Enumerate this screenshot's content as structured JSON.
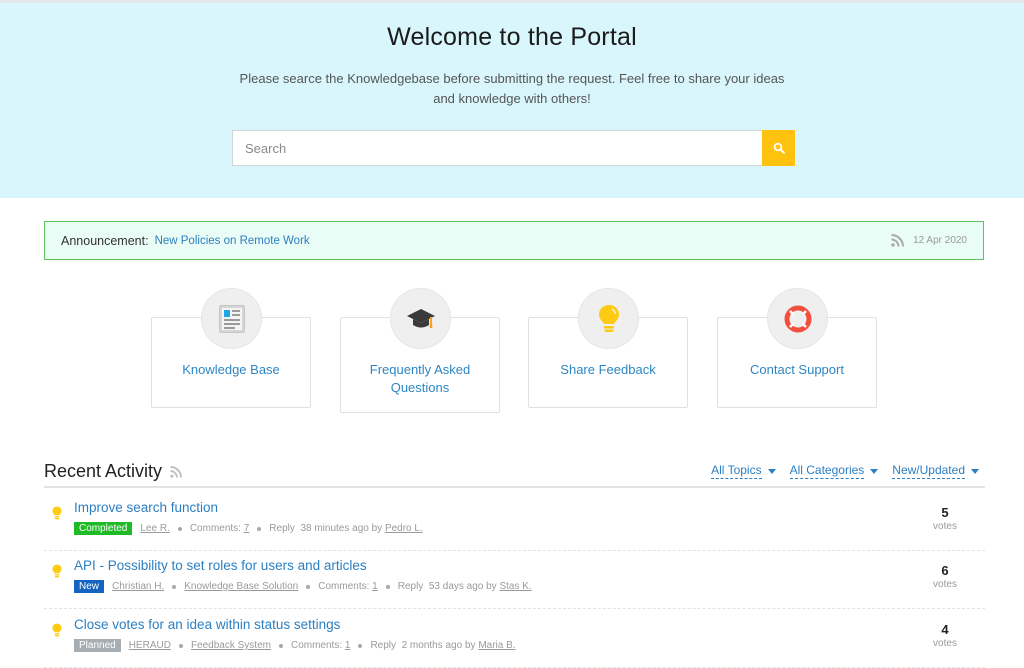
{
  "hero": {
    "title": "Welcome to the Portal",
    "subtitle": "Please searce the Knowledgebase before submitting the request. Feel free to share your ideas and knowledge with others!",
    "search_placeholder": "Search",
    "search_value": "",
    "search_button_icon": "search-icon",
    "accent_color": "#ffc20e"
  },
  "announcement": {
    "label": "Announcement:",
    "link_text": "New Policies on Remote Work",
    "icon": "rss-icon",
    "date": "12 Apr 2020"
  },
  "tiles": [
    {
      "label": "Knowledge Base",
      "icon": "newspaper-icon"
    },
    {
      "label": "Frequently Asked Questions",
      "icon": "graduation-cap-icon"
    },
    {
      "label": "Share Feedback",
      "icon": "lightbulb-icon"
    },
    {
      "label": "Contact Support",
      "icon": "life-ring-icon"
    }
  ],
  "recent_activity": {
    "title": "Recent Activity",
    "filters": [
      {
        "label": "All Topics"
      },
      {
        "label": "All Categories"
      },
      {
        "label": "New/Updated"
      }
    ],
    "items": [
      {
        "title": "Improve search function",
        "status": "Completed",
        "status_color": "#1fbb27",
        "author": "Lee R.",
        "category": null,
        "comments_label": "Comments:",
        "comments": "7",
        "reply_label": "Reply",
        "reply_time": "38 minutes ago by",
        "reply_user": "Pedro L.",
        "votes": "5",
        "votes_label": "votes"
      },
      {
        "title": "API - Possibility to set roles for users and articles",
        "status": "New",
        "status_color": "#1465c0",
        "author": "Christian H.",
        "category": "Knowledge Base Solution",
        "comments_label": "Comments:",
        "comments": "1",
        "reply_label": "Reply",
        "reply_time": "53 days ago by",
        "reply_user": "Stas K.",
        "votes": "6",
        "votes_label": "votes"
      },
      {
        "title": "Close votes for an idea within status settings",
        "status": "Planned",
        "status_color": "#a6adb3",
        "author": "HERAUD",
        "category": "Feedback System",
        "comments_label": "Comments:",
        "comments": "1",
        "reply_label": "Reply",
        "reply_time": "2 months ago by",
        "reply_user": "Maria B.",
        "votes": "4",
        "votes_label": "votes"
      }
    ]
  }
}
